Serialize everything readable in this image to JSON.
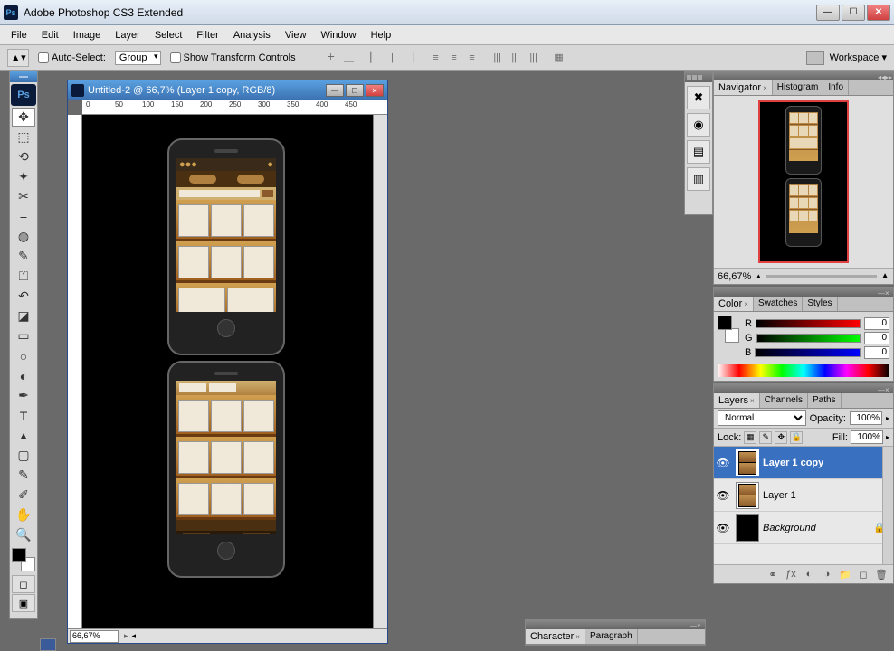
{
  "app": {
    "title": "Adobe Photoshop CS3 Extended"
  },
  "menu": [
    "File",
    "Edit",
    "Image",
    "Layer",
    "Select",
    "Filter",
    "Analysis",
    "View",
    "Window",
    "Help"
  ],
  "options": {
    "auto_select_label": "Auto-Select:",
    "auto_select_mode": "Group",
    "show_transform_label": "Show Transform Controls",
    "workspace_label": "Workspace ▾"
  },
  "document": {
    "title": "Untitled-2 @ 66,7% (Layer 1 copy, RGB/8)",
    "zoom": "66,67%",
    "ruler_h": [
      "0",
      "50",
      "100",
      "150",
      "200",
      "250",
      "300",
      "350",
      "400",
      "450"
    ]
  },
  "navigator": {
    "tabs": [
      "Navigator",
      "Histogram",
      "Info"
    ],
    "zoom": "66,67%"
  },
  "color": {
    "tabs": [
      "Color",
      "Swatches",
      "Styles"
    ],
    "channels": [
      {
        "label": "R",
        "value": "0"
      },
      {
        "label": "G",
        "value": "0"
      },
      {
        "label": "B",
        "value": "0"
      }
    ]
  },
  "layers": {
    "tabs": [
      "Layers",
      "Channels",
      "Paths"
    ],
    "blend_mode": "Normal",
    "opacity_label": "Opacity:",
    "opacity": "100%",
    "lock_label": "Lock:",
    "fill_label": "Fill:",
    "fill": "100%",
    "items": [
      {
        "name": "Layer 1 copy",
        "visible": true,
        "selected": true
      },
      {
        "name": "Layer 1",
        "visible": true,
        "selected": false
      },
      {
        "name": "Background",
        "visible": true,
        "selected": false,
        "locked": true,
        "italic": true
      }
    ]
  },
  "bottom_panel": {
    "tabs": [
      "Character",
      "Paragraph"
    ]
  }
}
